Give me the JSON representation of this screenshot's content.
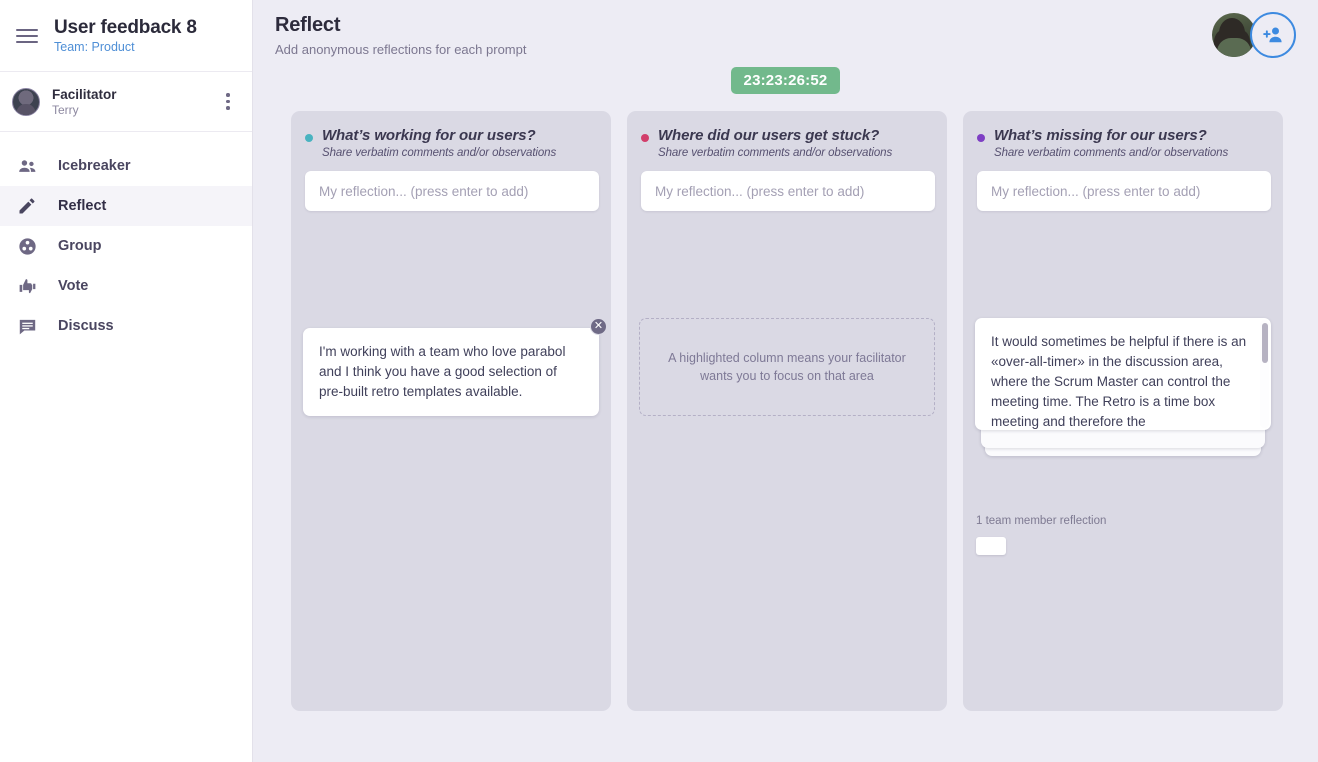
{
  "sidebar": {
    "menu_icon": "hamburger-icon",
    "project_title": "User feedback 8",
    "team_label": "Team: Product",
    "user": {
      "role": "Facilitator",
      "name": "Terry",
      "menu_icon": "kebab-menu-icon",
      "avatar_icon": "facilitator-avatar"
    },
    "items": [
      {
        "label": "Icebreaker",
        "icon": "people-icon",
        "active": false
      },
      {
        "label": "Reflect",
        "icon": "pencil-icon",
        "active": true
      },
      {
        "label": "Group",
        "icon": "group-circles-icon",
        "active": false
      },
      {
        "label": "Vote",
        "icon": "thumbs-up-down-icon",
        "active": false
      },
      {
        "label": "Discuss",
        "icon": "chat-bubble-icon",
        "active": false
      }
    ]
  },
  "header": {
    "title": "Reflect",
    "subtitle": "Add anonymous reflections for each prompt",
    "timer": "23:23:26:52",
    "avatar_icon": "user-avatar",
    "add_user_icon": "add-person-icon"
  },
  "colors": {
    "timer_green": "#72b98c",
    "accent_blue": "#3d8ae0",
    "team_link": "#4f8fd6",
    "column_bg": "#dad9e4",
    "page_bg": "#edecf4",
    "dot_teal": "#49b3c0",
    "dot_crimson": "#d23e6b",
    "dot_purple": "#7e3fc4"
  },
  "board": {
    "columns": [
      {
        "title": "What’s working for our users?",
        "subtitle": "Share verbatim comments and/or observations",
        "dot_color": "#49b3c0",
        "input_placeholder": "My reflection... (press enter to add)",
        "input_value": "",
        "card_text": "I'm working with a team who love parabol and I think you have a good selection of pre-built retro templates available.",
        "close_icon": "close-icon"
      },
      {
        "title": "Where did our users get stuck?",
        "subtitle": "Share verbatim comments and/or observations",
        "dot_color": "#d23e6b",
        "input_placeholder": "My reflection... (press enter to add)",
        "input_value": "",
        "placeholder_text": "A highlighted column means your facilitator wants you to focus on that area"
      },
      {
        "title": "What’s missing for our users?",
        "subtitle": "Share verbatim comments and/or observations",
        "dot_color": "#7e3fc4",
        "input_placeholder": "My reflection... (press enter to add)",
        "input_value": "",
        "card_text": "It would sometimes be helpful if there is an «over-all-timer» in the discussion area, where the Scrum Master can control the meeting time. The Retro is a time box meeting and therefore the",
        "meta_text": "1 team member reflection"
      }
    ]
  }
}
